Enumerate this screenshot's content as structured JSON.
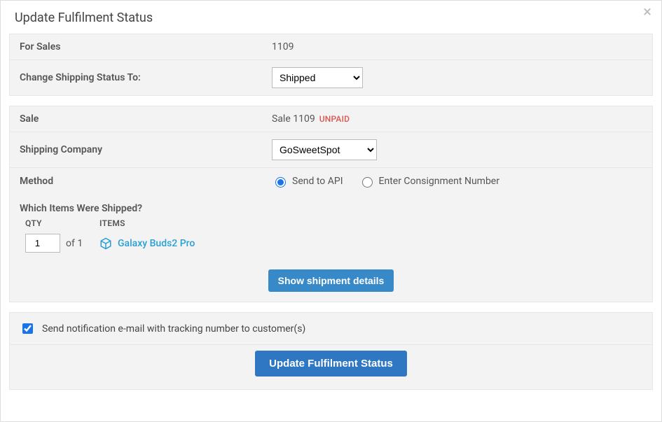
{
  "header": {
    "title": "Update Fulfilment Status"
  },
  "panel1": {
    "for_sales_label": "For Sales",
    "for_sales_value": "1109",
    "change_status_label": "Change Shipping Status To:",
    "status_selected": "Shipped"
  },
  "panel2": {
    "sale_label": "Sale",
    "sale_value": "Sale 1109",
    "sale_badge": "UNPAID",
    "company_label": "Shipping Company",
    "company_selected": "GoSweetSpot",
    "method_label": "Method",
    "method_opt_api": "Send to API",
    "method_opt_manual": "Enter Consignment Number",
    "items_section_title": "Which Items Were Shipped?",
    "col_qty": "QTY",
    "col_items": "ITEMS",
    "items": [
      {
        "qty": "1",
        "of": "of 1",
        "name": "Galaxy Buds2 Pro"
      }
    ],
    "show_details_btn": "Show shipment details"
  },
  "footer": {
    "notify_label": "Send notification e-mail with tracking number to customer(s)",
    "submit_btn": "Update Fulfilment Status"
  }
}
